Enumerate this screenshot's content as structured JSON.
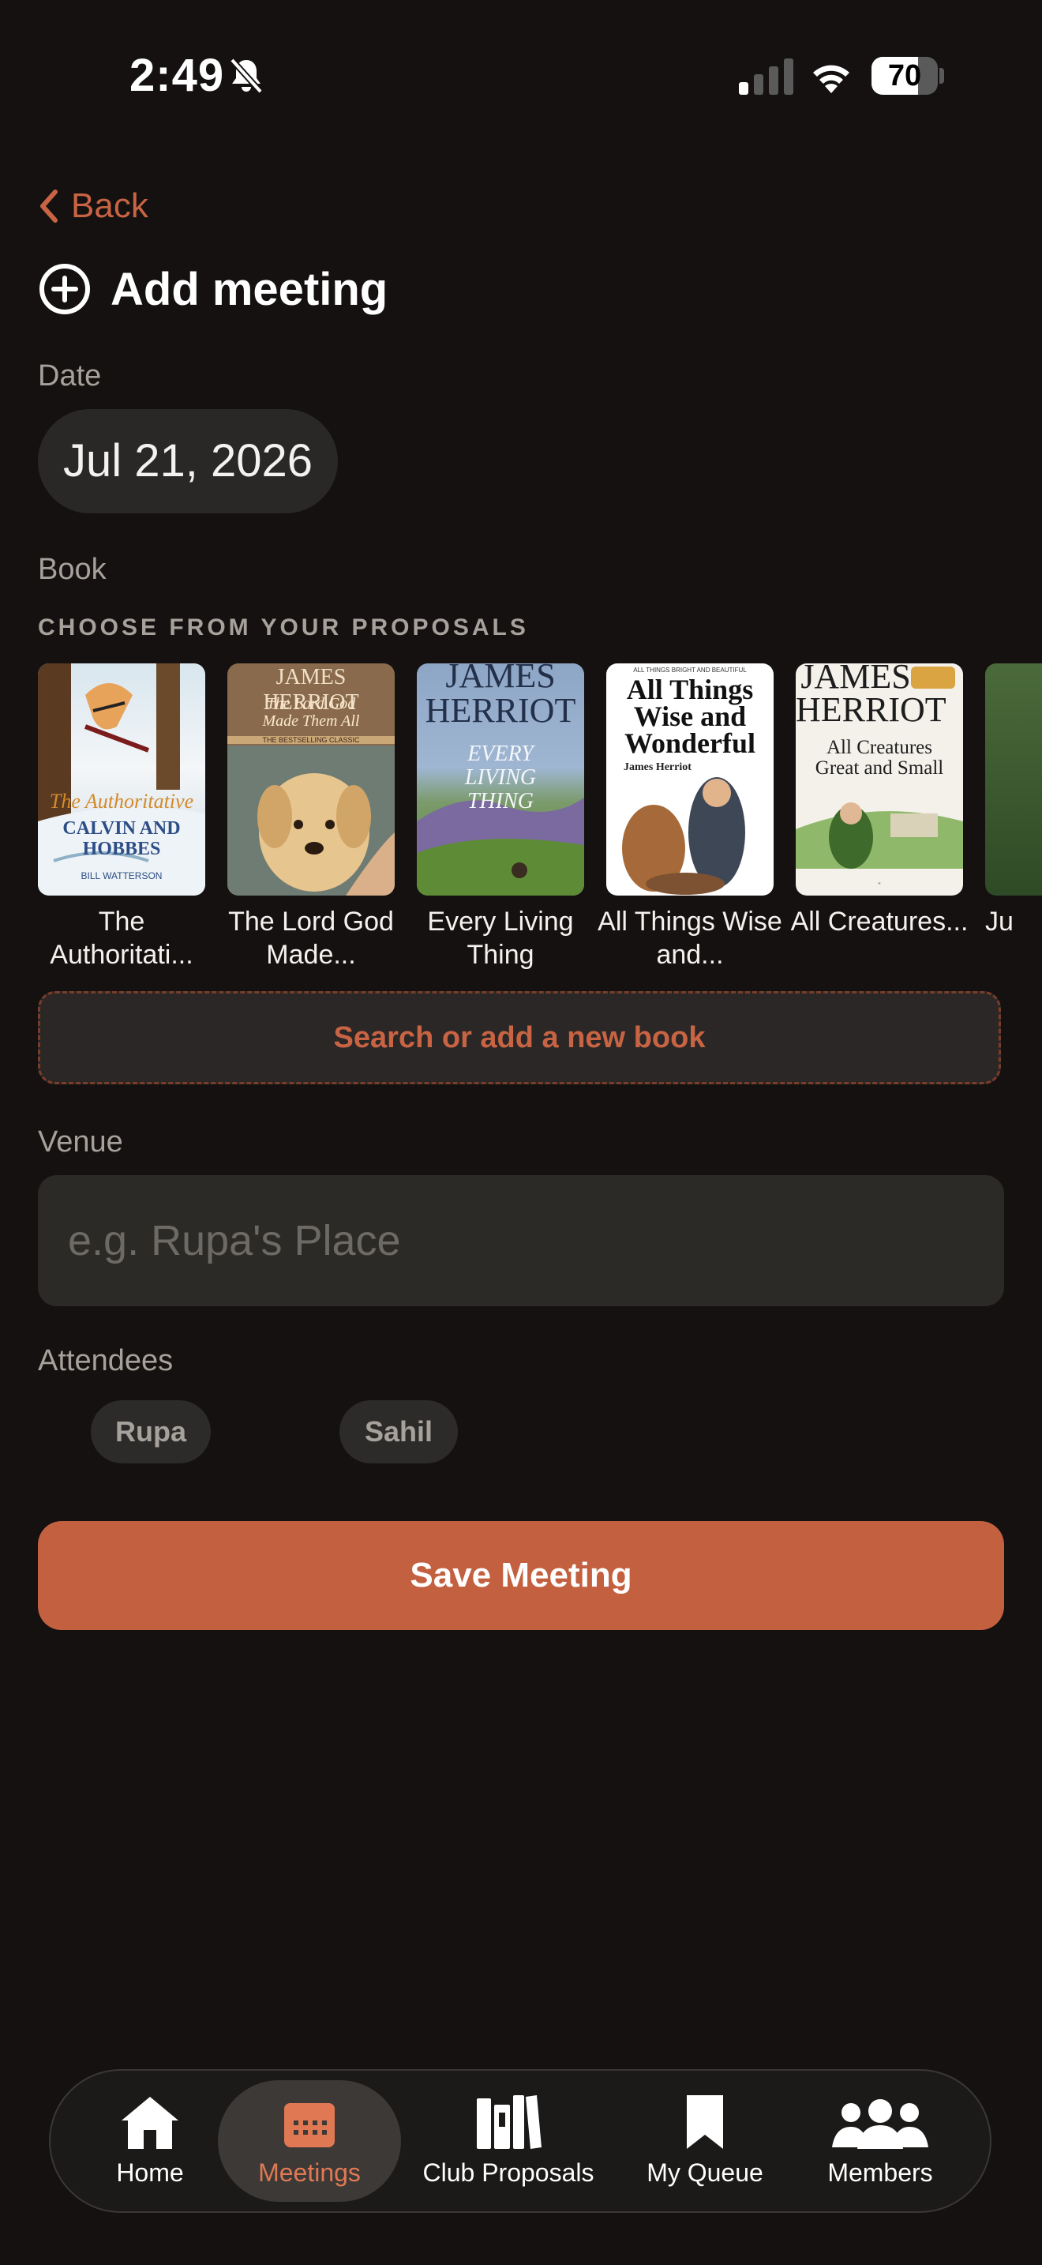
{
  "status": {
    "time": "2:49",
    "battery": "70",
    "battery_level": 0.7
  },
  "nav": {
    "back_label": "Back"
  },
  "page": {
    "title": "Add meeting"
  },
  "date": {
    "label": "Date",
    "value": "Jul 21, 2026"
  },
  "book": {
    "label": "Book",
    "proposals_label": "CHOOSE FROM YOUR PROPOSALS",
    "items": [
      {
        "title": "The Authoritati...",
        "cover_title": "CALVIN AND HOBBES",
        "cover_sub": "The Authoritative",
        "cover_author": "BILL WATTERSON"
      },
      {
        "title": "The Lord God Made...",
        "cover_title": "The Lord God Made Them All",
        "cover_author": "JAMES HERRIOT",
        "cover_sub": "THE BESTSELLING CLASSIC"
      },
      {
        "title": "Every Living Thing",
        "cover_title": "EVERY LIVING THING",
        "cover_author": "JAMES HERRIOT"
      },
      {
        "title": "All Things Wise and...",
        "cover_title": "All Things Wise and Wonderful",
        "cover_author": "James Herriot",
        "cover_sub": "ALL THINGS BRIGHT AND BEAUTIFUL"
      },
      {
        "title": "All Creatures...",
        "cover_title": "All Creatures Great and Small",
        "cover_author": "JAMES HERRIOT"
      },
      {
        "title": "Ju"
      }
    ],
    "search_label": "Search or add a new book"
  },
  "venue": {
    "label": "Venue",
    "placeholder": "e.g. Rupa's Place",
    "value": ""
  },
  "attendees": {
    "label": "Attendees",
    "people": [
      "Rupa",
      "Sahil"
    ]
  },
  "save_label": "Save Meeting",
  "tabs": [
    {
      "label": "Home",
      "icon": "house-icon"
    },
    {
      "label": "Meetings",
      "icon": "calendar-icon",
      "active": true
    },
    {
      "label": "Club Proposals",
      "icon": "books-icon"
    },
    {
      "label": "My Queue",
      "icon": "bookmark-icon"
    },
    {
      "label": "Members",
      "icon": "people-icon"
    }
  ],
  "colors": {
    "accent": "#c36040",
    "background": "#141110",
    "surface": "#2a2827"
  }
}
